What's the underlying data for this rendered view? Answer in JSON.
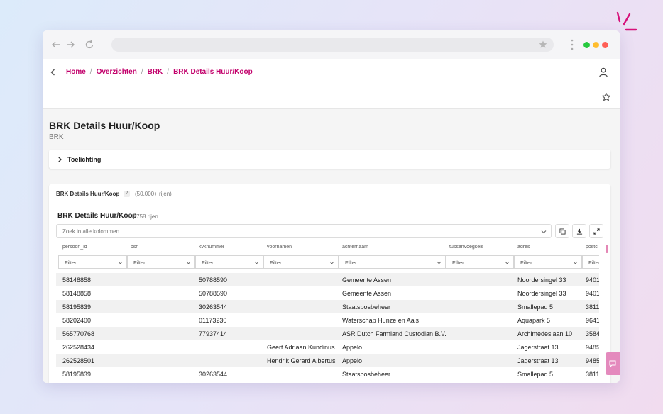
{
  "browser": {
    "window_dots": [
      "#27c93f",
      "#ffbd2e",
      "#ff5f56"
    ]
  },
  "breadcrumb": {
    "items": [
      "Home",
      "Overzichten",
      "BRK",
      "BRK Details Huur/Koop"
    ],
    "separator": "/"
  },
  "page": {
    "title": "BRK Details Huur/Koop",
    "subtitle": "BRK"
  },
  "accordion": {
    "label": "Toelichting"
  },
  "panel": {
    "title": "BRK Details Huur/Koop",
    "help": "?",
    "count": "(50.000+ rijen)"
  },
  "grid": {
    "title": "BRK Details Huur/Koop",
    "row_count": "58.758 rijen",
    "search_placeholder": "Zoek in alle kolommen...",
    "filter_placeholder": "Filter...",
    "columns": [
      "persoon_id",
      "bsn",
      "kvknummer",
      "voornamen",
      "achternaam",
      "tussenvoegsels",
      "adres",
      "postc"
    ],
    "rows": [
      [
        "58148858",
        "",
        "50788590",
        "",
        "Gemeente Assen",
        "",
        "Noordersingel 33",
        "9401"
      ],
      [
        "58148858",
        "",
        "50788590",
        "",
        "Gemeente Assen",
        "",
        "Noordersingel 33",
        "9401"
      ],
      [
        "58195839",
        "",
        "30263544",
        "",
        "Staatsbosbeheer",
        "",
        "Smallepad 5",
        "3811"
      ],
      [
        "58202400",
        "",
        "01173230",
        "",
        "Waterschap Hunze en Aa's",
        "",
        "Aquapark 5",
        "9641"
      ],
      [
        "565770768",
        "",
        "77937414",
        "",
        "ASR Dutch Farmland Custodian B.V.",
        "",
        "Archimedeslaan 10",
        "3584"
      ],
      [
        "262528434",
        "",
        "",
        "Geert Adriaan Kundinus",
        "Appelo",
        "",
        "Jagerstraat 13",
        "9485"
      ],
      [
        "262528501",
        "",
        "",
        "Hendrik Gerard Albertus",
        "Appelo",
        "",
        "Jagerstraat 13",
        "9485"
      ],
      [
        "58195839",
        "",
        "30263544",
        "",
        "Staatsbosbeheer",
        "",
        "Smallepad 5",
        "3811"
      ]
    ]
  },
  "colors": {
    "accent": "#c2006b",
    "feedback": "#e48abd"
  },
  "icons": {
    "back": "arrow-left-icon",
    "forward": "arrow-right-icon",
    "reload": "reload-icon",
    "bookmark": "star-icon",
    "menu": "kebab-icon",
    "user": "user-icon",
    "favorite": "star-outline-icon",
    "copy": "copy-icon",
    "download": "download-icon",
    "expand": "expand-icon",
    "feedback": "chat-icon"
  }
}
